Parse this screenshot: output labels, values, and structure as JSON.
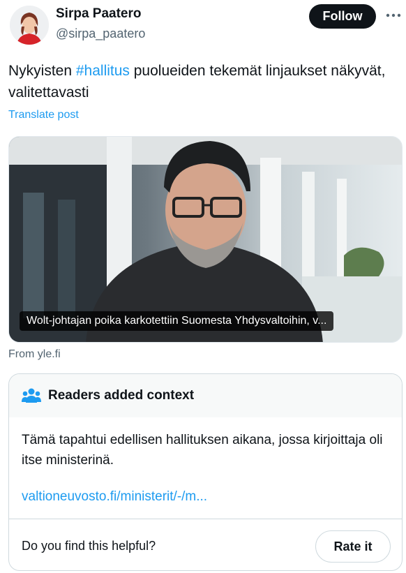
{
  "author": {
    "name": "Sirpa Paatero",
    "handle": "@sirpa_paatero",
    "follow_label": "Follow",
    "more_icon": "more-horizontal-icon"
  },
  "post": {
    "text_before": "Nykyisten ",
    "hashtag": "#hallitus",
    "text_after": " puolueiden tekemät linjaukset näkyvät, valitettavasti",
    "translate_label": "Translate post"
  },
  "media": {
    "caption": "Wolt-johtajan poika karkotettiin Suomesta Yhdysvaltoihin, v...",
    "source": "From yle.fi"
  },
  "community_note": {
    "title": "Readers added context",
    "icon": "people-icon",
    "body": "Tämä tapahtui edellisen hallituksen aikana, jossa kirjoittaja oli itse ministerinä.",
    "link": "valtioneuvosto.fi/ministerit/-/m...",
    "helpful_question": "Do you find this helpful?",
    "rate_label": "Rate it"
  },
  "colors": {
    "accent": "#1d9bf0",
    "text": "#0f1419",
    "muted": "#536471",
    "border": "#cfd9de"
  }
}
